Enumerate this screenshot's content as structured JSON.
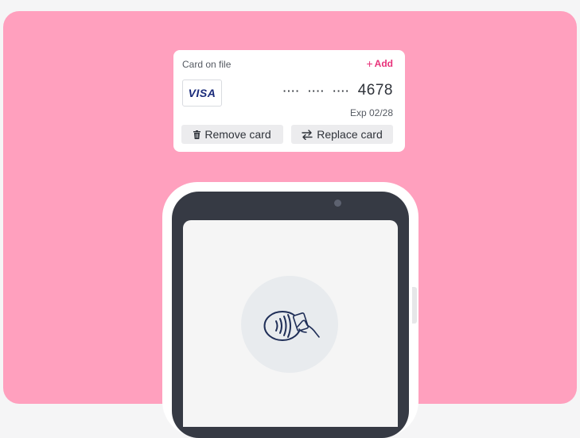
{
  "card_panel": {
    "title": "Card on file",
    "add_label": "Add",
    "brand": "VISA",
    "masked_groups": [
      "····",
      "····",
      "····"
    ],
    "last4": "4678",
    "expiry": "Exp 02/28",
    "remove_label": "Remove card",
    "replace_label": "Replace card"
  },
  "icons": {
    "add": "plus-icon",
    "remove": "trash-icon",
    "replace": "swap-arrows-icon",
    "contactless": "contactless-tap-icon"
  },
  "colors": {
    "background": "#ffa0be",
    "accent": "#e8327a",
    "visa_blue": "#1a2b7a",
    "phone_body": "#363a44"
  }
}
